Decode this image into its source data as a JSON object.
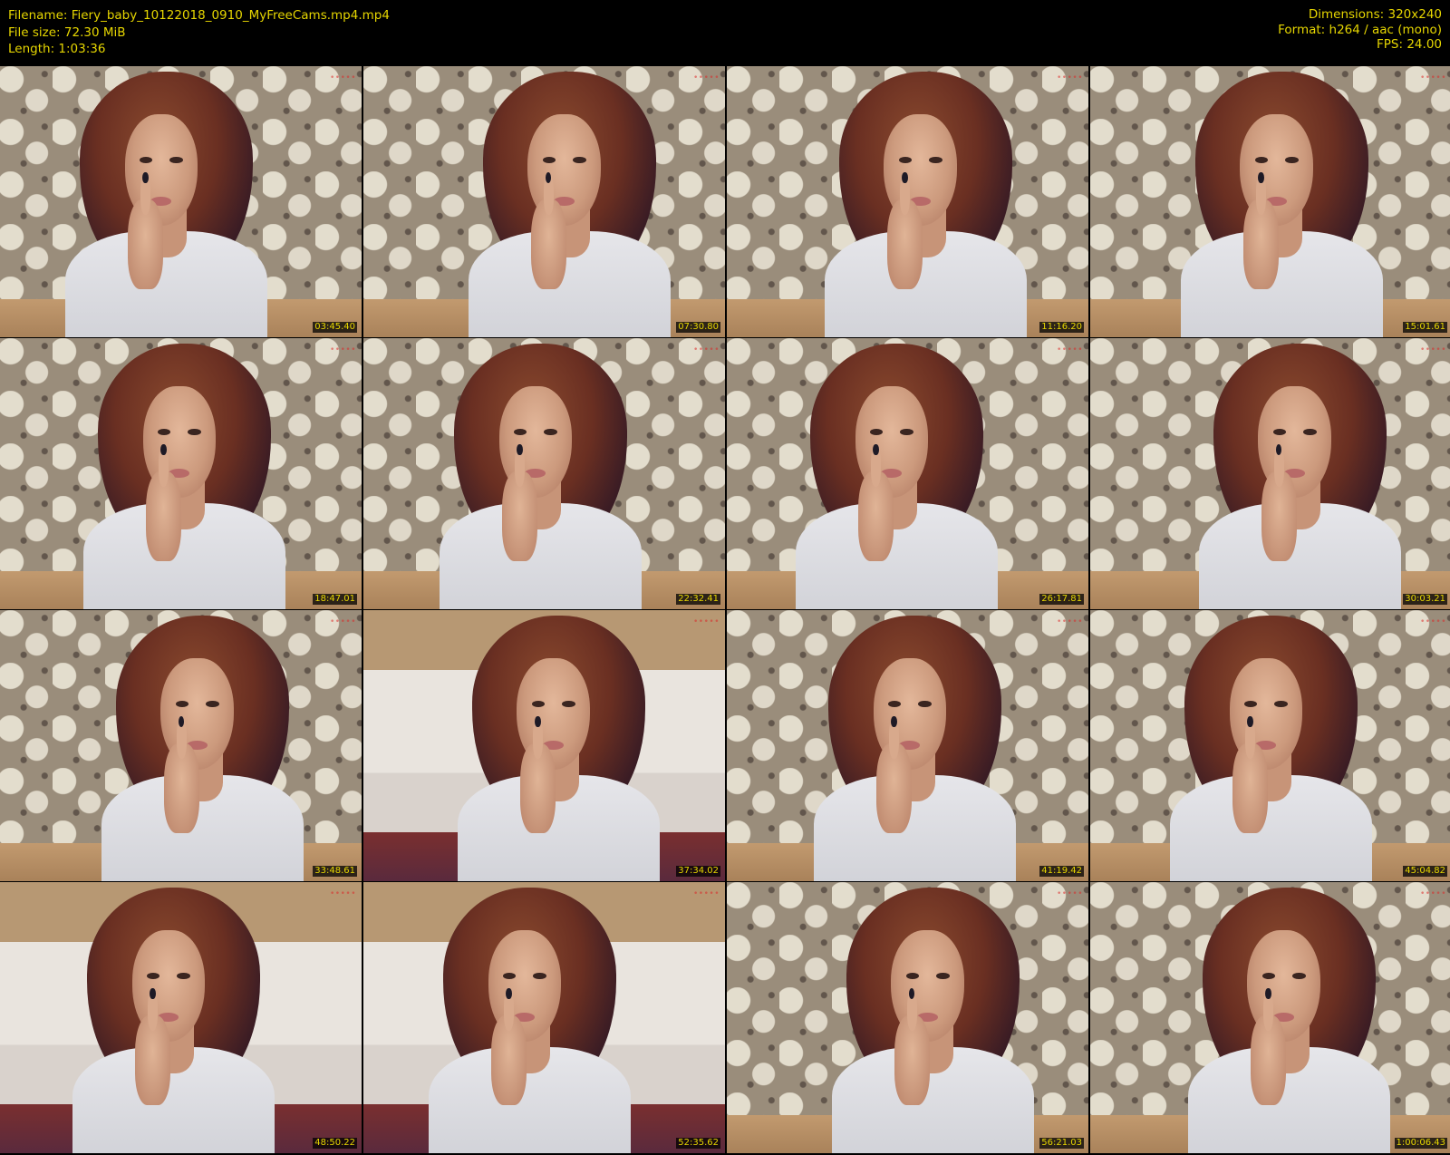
{
  "header": {
    "filename_line": "Filename: Fiery_baby_10122018_0910_MyFreeCams.mp4.mp4",
    "filesize_line": "File size: 72.30 MiB",
    "length_line": "Length: 1:03:36",
    "dimensions_line": "Dimensions: 320x240",
    "format_line": "Format: h264 / aac (mono)",
    "fps_line": "FPS: 24.00"
  },
  "colors": {
    "background": "#000000",
    "metadata_text": "#e6d600",
    "timestamp_text": "#e6d600"
  },
  "thumbnails": [
    {
      "timestamp": "03:45.40",
      "scene": "wallpaper"
    },
    {
      "timestamp": "07:30.80",
      "scene": "wallpaper"
    },
    {
      "timestamp": "11:16.20",
      "scene": "wallpaper"
    },
    {
      "timestamp": "15:01.61",
      "scene": "wallpaper"
    },
    {
      "timestamp": "18:47.01",
      "scene": "wallpaper"
    },
    {
      "timestamp": "22:32.41",
      "scene": "wallpaper"
    },
    {
      "timestamp": "26:17.81",
      "scene": "wallpaper"
    },
    {
      "timestamp": "30:03.21",
      "scene": "wallpaper"
    },
    {
      "timestamp": "33:48.61",
      "scene": "wallpaper"
    },
    {
      "timestamp": "37:34.02",
      "scene": "bed"
    },
    {
      "timestamp": "41:19.42",
      "scene": "wallpaper"
    },
    {
      "timestamp": "45:04.82",
      "scene": "wallpaper"
    },
    {
      "timestamp": "48:50.22",
      "scene": "bed"
    },
    {
      "timestamp": "52:35.62",
      "scene": "bed"
    },
    {
      "timestamp": "56:21.03",
      "scene": "wallpaper"
    },
    {
      "timestamp": "1:00:06.43",
      "scene": "wallpaper"
    }
  ]
}
